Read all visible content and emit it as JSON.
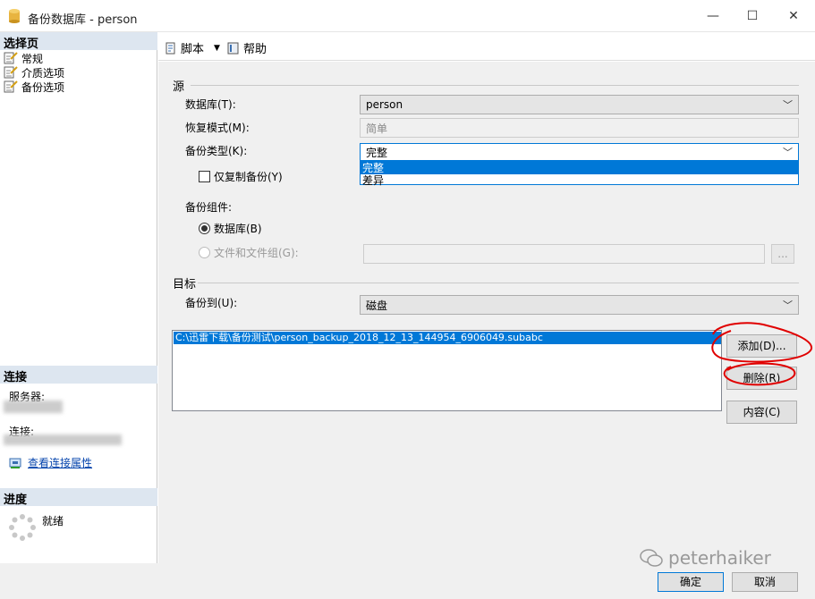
{
  "window": {
    "title": "备份数据库 - person",
    "minimize_glyph": "—",
    "maximize_glyph": "☐",
    "close_glyph": "✕"
  },
  "left_pane": {
    "pages_header": "选择页",
    "pages": [
      {
        "label": "常规",
        "icon": "page-icon"
      },
      {
        "label": "介质选项",
        "icon": "page-icon"
      },
      {
        "label": "备份选项",
        "icon": "page-icon"
      }
    ],
    "connection_header": "连接",
    "server_label": "服务器:",
    "connection_label": "连接:",
    "view_connection_link": "查看连接属性",
    "progress_header": "进度",
    "progress_status": "就绪"
  },
  "toolbar": {
    "script_label": "脚本",
    "help_label": "帮助"
  },
  "source": {
    "group_label": "源",
    "database_label": "数据库(T):",
    "database_value": "person",
    "recovery_label": "恢复模式(M):",
    "recovery_value": "简单",
    "backup_type_label": "备份类型(K):",
    "backup_type_value": "完整",
    "backup_type_options": [
      "完整",
      "差异"
    ],
    "copy_only_label": "仅复制备份(Y)",
    "component_label": "备份组件:",
    "radio_database_label": "数据库(B)",
    "radio_files_label": "文件和文件组(G):",
    "browse_label": "..."
  },
  "destination": {
    "group_label": "目标",
    "backup_to_label": "备份到(U):",
    "backup_to_value": "磁盘",
    "paths": [
      "C:\\迅雷下载\\备份测试\\person_backup_2018_12_13_144954_6906049.subabc"
    ],
    "add_button": "添加(D)...",
    "remove_button": "删除(R)",
    "contents_button": "内容(C)"
  },
  "footer": {
    "ok_button": "确定",
    "cancel_button": "取消",
    "watermark": "peterhaiker"
  },
  "colors": {
    "accent": "#0078d7",
    "annotation": "#e00000"
  }
}
